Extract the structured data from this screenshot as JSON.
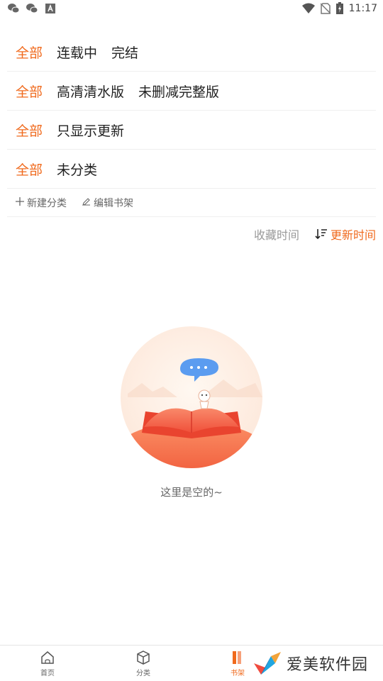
{
  "status_bar": {
    "time": "11:17",
    "left_icons": [
      "wechat-icon",
      "wechat-icon",
      "notification-a-icon"
    ],
    "right_icons": [
      "wifi-icon",
      "no-sim-icon",
      "battery-charging-icon"
    ]
  },
  "filters": {
    "row1": {
      "all": "全部",
      "options": [
        "连载中",
        "完结"
      ]
    },
    "row2": {
      "all": "全部",
      "options": [
        "高清清水版",
        "未删减完整版"
      ]
    },
    "row3": {
      "all": "全部",
      "options": [
        "只显示更新"
      ]
    },
    "row4": {
      "all": "全部",
      "options": [
        "未分类"
      ]
    }
  },
  "actions": {
    "new_category": "新建分类",
    "edit_shelf": "编辑书架"
  },
  "sort": {
    "favorite_time": "收藏时间",
    "update_time": "更新时间"
  },
  "empty": {
    "message": "这里是空的~"
  },
  "bottom_nav": {
    "home": "首页",
    "category": "分类",
    "shelf": "书架"
  },
  "watermark": {
    "text": "爱美软件园"
  },
  "colors": {
    "accent": "#f06a1d",
    "text": "#222222",
    "muted": "#999999",
    "divider": "#efefef"
  }
}
